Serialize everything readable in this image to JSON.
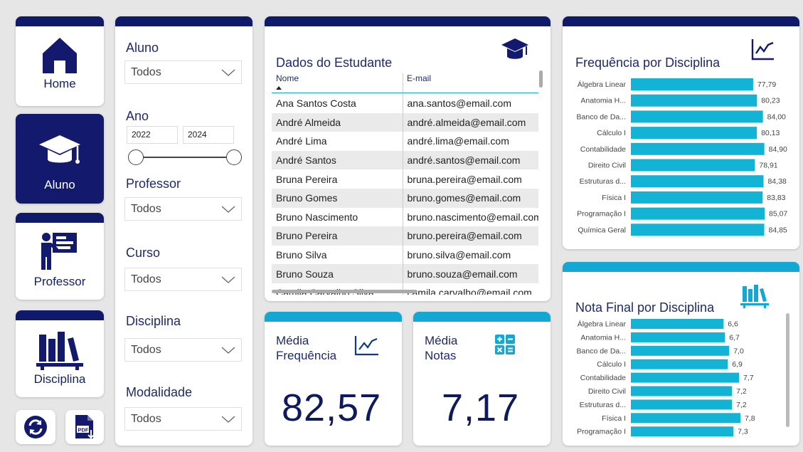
{
  "nav": {
    "home_label": "Home",
    "aluno_label": "Aluno",
    "professor_label": "Professor",
    "disciplina_label": "Disciplina"
  },
  "filters": {
    "aluno": {
      "label": "Aluno",
      "value": "Todos"
    },
    "ano": {
      "label": "Ano",
      "start": "2022",
      "end": "2024"
    },
    "professor": {
      "label": "Professor",
      "value": "Todos"
    },
    "curso": {
      "label": "Curso",
      "value": "Todos"
    },
    "disciplina": {
      "label": "Disciplina",
      "value": "Todos"
    },
    "modalidade": {
      "label": "Modalidade",
      "value": "Todos"
    }
  },
  "students_table": {
    "title": "Dados do Estudante",
    "columns": [
      "Nome",
      "E-mail"
    ],
    "rows": [
      [
        "Ana Santos Costa",
        "ana.santos@email.com"
      ],
      [
        "André Almeida",
        "andré.almeida@email.com"
      ],
      [
        "André Lima",
        "andré.lima@email.com"
      ],
      [
        "André Santos",
        "andré.santos@email.com"
      ],
      [
        "Bruna Pereira",
        "bruna.pereira@email.com"
      ],
      [
        "Bruno Gomes",
        "bruno.gomes@email.com"
      ],
      [
        "Bruno Nascimento",
        "bruno.nascimento@email.com"
      ],
      [
        "Bruno Pereira",
        "bruno.pereira@email.com"
      ],
      [
        "Bruno Silva",
        "bruno.silva@email.com"
      ],
      [
        "Bruno Souza",
        "bruno.souza@email.com"
      ],
      [
        "Camila Carvalho Silva",
        "camila.carvalho@email.com"
      ]
    ]
  },
  "kpis": {
    "media_frequencia": {
      "title_line1": "Média",
      "title_line2": "Frequência",
      "value": "82,57"
    },
    "media_notas": {
      "title_line1": "Média",
      "title_line2": "Notas",
      "value": "7,17"
    }
  },
  "colors": {
    "navy": "#0f1a6b",
    "teal": "#14a7d3",
    "bar": "#13b3d6"
  },
  "chart_data": [
    {
      "type": "bar",
      "orientation": "horizontal",
      "title": "Frequência por Disciplina",
      "categories": [
        "Álgebra Linear",
        "Anatomia H...",
        "Banco de Da...",
        "Cálculo I",
        "Contabilidade",
        "Direito Civil",
        "Estruturas d...",
        "Física I",
        "Programação I",
        "Química Geral"
      ],
      "values": [
        77.79,
        80.23,
        84.0,
        80.13,
        84.9,
        78.91,
        84.38,
        83.83,
        85.07,
        84.85
      ],
      "labels": [
        "77,79",
        "80,23",
        "84,00",
        "80,13",
        "84,90",
        "78,91",
        "84,38",
        "83,83",
        "85,07",
        "84,85"
      ]
    },
    {
      "type": "bar",
      "orientation": "horizontal",
      "title": "Nota Final por Disciplina",
      "categories": [
        "Álgebra Linear",
        "Anatomia H...",
        "Banco de Da...",
        "Cálculo I",
        "Contabilidade",
        "Direito Civil",
        "Estruturas d...",
        "Física I",
        "Programação I"
      ],
      "values": [
        6.6,
        6.7,
        7.0,
        6.9,
        7.7,
        7.2,
        7.2,
        7.8,
        7.3
      ],
      "labels": [
        "6,6",
        "6,7",
        "7,0",
        "6,9",
        "7,7",
        "7,2",
        "7,2",
        "7,8",
        "7,3"
      ]
    }
  ]
}
